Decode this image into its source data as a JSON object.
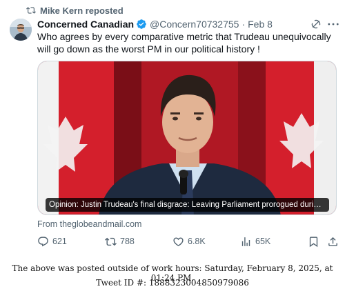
{
  "repost": {
    "label": "Mike Kern reposted",
    "icon": "repost-icon"
  },
  "tweet": {
    "display_name": "Concerned Canadian",
    "handle": "@Concern70732755",
    "separator": "·",
    "date": "Feb 8",
    "text": "Who agrees by every comparative metric that Trudeau unequivocally will go down as the worst PM in our political history !",
    "verified_color": "#1d9bf0",
    "media_caption": "Opinion: Justin Trudeau's final disgrace: Leaving Parliament prorogued during a c...",
    "source": "From theglobeandmail.com"
  },
  "actions": {
    "replies": "621",
    "reposts": "788",
    "likes": "6.8K",
    "views": "65K"
  },
  "footer": {
    "line1": "The above was posted outside of work hours: Saturday, February 8, 2025, at 01:24 PM.",
    "line2": "Tweet ID #: 1888323004850979086"
  }
}
